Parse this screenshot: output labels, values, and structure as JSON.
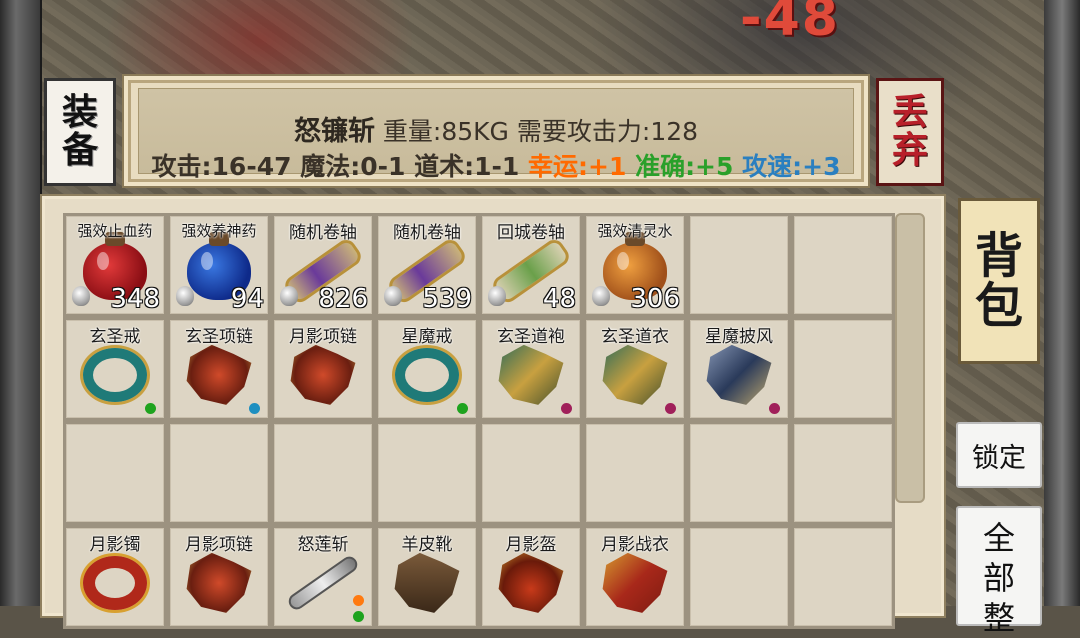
{
  "hud": {
    "damage_text": "-48"
  },
  "buttons": {
    "equip": [
      "装",
      "备"
    ],
    "discard": [
      "丢",
      "弃"
    ],
    "bag": [
      "背",
      "包"
    ],
    "lock": "锁定",
    "sort_all": [
      "全",
      "部",
      "整"
    ]
  },
  "item_info": {
    "name": "怒镰斩",
    "weight": "重量:85KG",
    "requirement": "需要攻击力:128",
    "attack": "攻击:16-47",
    "magic": "魔法:0-1",
    "taoism": "道术:1-1",
    "luck": "幸运:+1",
    "accuracy": "准确:+5",
    "attack_speed": "攻速:+3",
    "colors": {
      "luck": "#ff6a00",
      "accuracy": "#2aa02a",
      "attack_speed": "#2a7fc0"
    }
  },
  "bag": {
    "rows": [
      [
        {
          "name": "强效止血药",
          "qty": "348",
          "icon": "red-potion-icon",
          "bound": true
        },
        {
          "name": "强效养神药",
          "qty": "94",
          "icon": "blue-potion-icon",
          "bound": true
        },
        {
          "name": "随机卷轴",
          "qty": "826",
          "icon": "purple-scroll-icon",
          "bound": true
        },
        {
          "name": "随机卷轴",
          "qty": "539",
          "icon": "purple-scroll-icon",
          "bound": true
        },
        {
          "name": "回城卷轴",
          "qty": "48",
          "icon": "green-scroll-icon",
          "bound": true
        },
        {
          "name": "强效清灵水",
          "qty": "306",
          "icon": "orange-potion-icon",
          "bound": true
        },
        null,
        null
      ],
      [
        {
          "name": "玄圣戒",
          "icon": "ring-icon",
          "dots": [
            "#1ea31e"
          ]
        },
        {
          "name": "玄圣项链",
          "icon": "necklace-icon",
          "dots": [
            "#1e8fc0"
          ]
        },
        {
          "name": "月影项链",
          "icon": "necklace-icon",
          "dots": []
        },
        {
          "name": "星魔戒",
          "icon": "ring-icon",
          "dots": [
            "#1ea31e"
          ]
        },
        {
          "name": "玄圣道袍",
          "icon": "robe-icon",
          "dots": [
            "#a0205a"
          ]
        },
        {
          "name": "玄圣道衣",
          "icon": "robe-icon",
          "dots": [
            "#a0205a"
          ]
        },
        {
          "name": "星魔披风",
          "icon": "cape-icon",
          "dots": [
            "#a0205a"
          ]
        },
        null
      ],
      [
        null,
        null,
        null,
        null,
        null,
        null,
        null,
        null
      ],
      [
        {
          "name": "月影镯",
          "icon": "bracelet-icon",
          "dots": []
        },
        {
          "name": "月影项链",
          "icon": "necklace-icon",
          "dots": []
        },
        {
          "name": "怒莲斩",
          "icon": "sword-icon",
          "dots": [
            "#ff7a10",
            "#1ea31e"
          ]
        },
        {
          "name": "羊皮靴",
          "icon": "boots-icon",
          "dots": []
        },
        {
          "name": "月影盔",
          "icon": "helmet-icon",
          "dots": []
        },
        {
          "name": "月影战衣",
          "icon": "armor-icon",
          "dots": []
        },
        null,
        null
      ]
    ]
  }
}
